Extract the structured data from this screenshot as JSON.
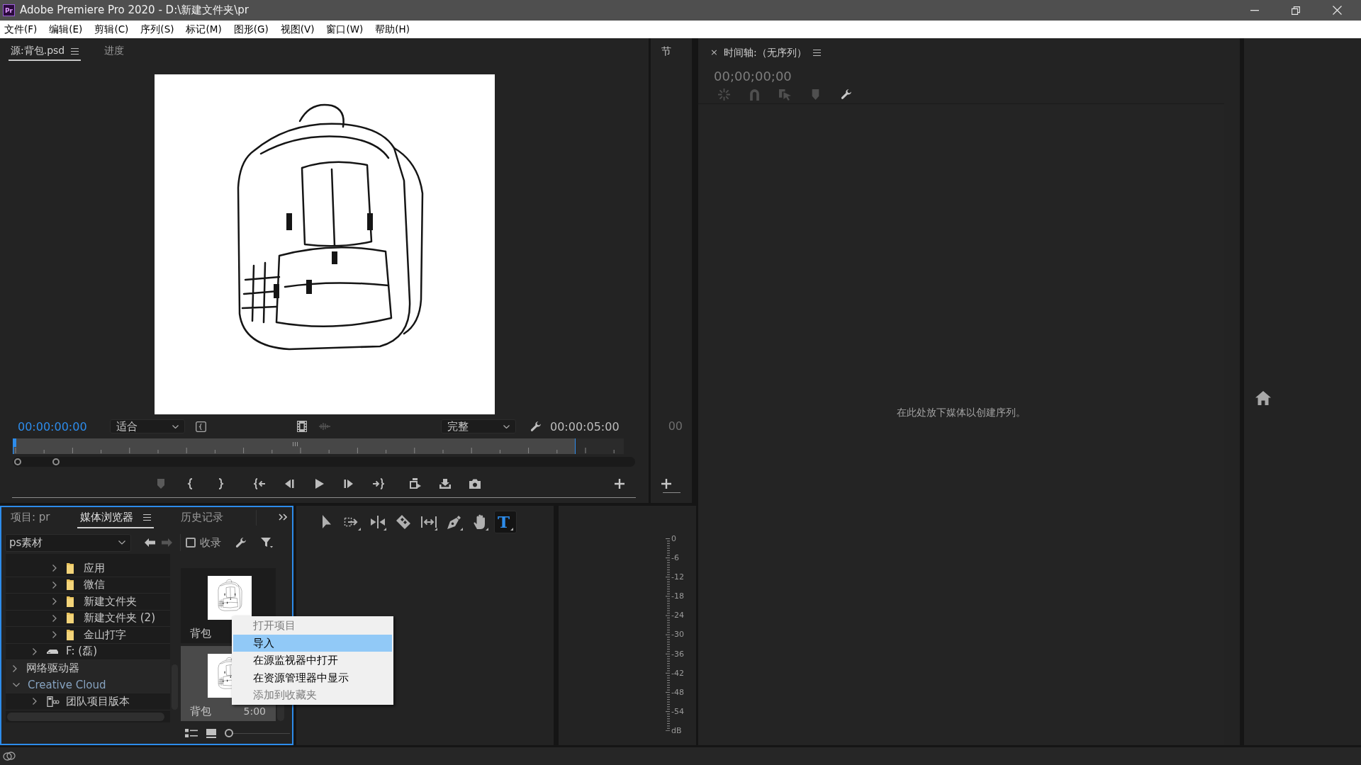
{
  "window": {
    "logo_text": "Pr",
    "title": "Adobe Premiere Pro 2020 - D:\\新建文件夹\\pr"
  },
  "menu_bar": [
    "文件(F)",
    "编辑(E)",
    "剪辑(C)",
    "序列(S)",
    "标记(M)",
    "图形(G)",
    "视图(V)",
    "窗口(W)",
    "帮助(H)"
  ],
  "source_monitor": {
    "tabs": [
      {
        "label": "源:背包.psd",
        "selected": true
      },
      {
        "label": "进度",
        "selected": false
      }
    ],
    "timecode": "00:00:00:00",
    "zoom_setting": "适合",
    "view_buttons": [
      {
        "kind": "video",
        "disabled": false
      },
      {
        "kind": "audio",
        "disabled": true
      }
    ],
    "resolution": "完整",
    "duration": "00:00:05:00",
    "transport": [
      {
        "kind": "marker",
        "disabled": true
      },
      {
        "kind": "mark_in",
        "disabled": false
      },
      {
        "kind": "mark_out",
        "disabled": false
      },
      {
        "kind": "go_to_in",
        "disabled": false
      },
      {
        "kind": "step_back",
        "disabled": false
      },
      {
        "kind": "play",
        "disabled": false
      },
      {
        "kind": "step_forward",
        "disabled": false
      },
      {
        "kind": "go_to_out",
        "disabled": false
      },
      {
        "kind": "insert",
        "disabled": false
      },
      {
        "kind": "overwrite",
        "disabled": false
      },
      {
        "kind": "export_frame",
        "disabled": false
      }
    ]
  },
  "section_panel": {
    "title": "节",
    "timecode": "00"
  },
  "timeline": {
    "close_glyph": "×",
    "title": "时间轴:（无序列）",
    "timecode": "00;00;00;00",
    "toolbar": [
      {
        "kind": "nest",
        "disabled": true
      },
      {
        "kind": "snap",
        "disabled": true
      },
      {
        "kind": "linked",
        "disabled": true
      },
      {
        "kind": "marker",
        "disabled": true
      },
      {
        "kind": "settings",
        "disabled": false
      }
    ],
    "empty_message": "在此处放下媒体以创建序列。"
  },
  "project_panel": {
    "tabs": [
      {
        "label": "项目: pr",
        "selected": false
      },
      {
        "label": "媒体浏览器",
        "selected": true
      },
      {
        "label": "历史记录",
        "selected": false
      }
    ],
    "location": "ps素材",
    "nav_buttons": [
      {
        "kind": "back",
        "disabled": false
      },
      {
        "kind": "forward",
        "disabled": true
      }
    ],
    "ingest": {
      "label": "收录",
      "checked": false
    },
    "tree": [
      {
        "children": [
          {
            "children": [
              {
                "label": "应用",
                "kind": "folder",
                "expanded": false
              },
              {
                "label": "微信",
                "kind": "folder",
                "expanded": false
              },
              {
                "label": "新建文件夹",
                "kind": "folder",
                "expanded": false
              },
              {
                "label": "新建文件夹 (2)",
                "kind": "folder",
                "expanded": false
              },
              {
                "label": "金山打字",
                "kind": "folder",
                "expanded": false
              }
            ]
          },
          {
            "label": "F: (磊)",
            "kind": "drive",
            "expanded": false
          }
        ]
      },
      {
        "label": "网络驱动器",
        "kind": "location",
        "expanded": false
      },
      {
        "label": "Creative Cloud",
        "kind": "cloud",
        "expanded": true,
        "children": [
          {
            "label": "团队项目版本",
            "kind": "team",
            "expanded": false
          }
        ]
      }
    ],
    "clips": [
      {
        "name": "背包",
        "selected": false
      },
      {
        "name": "背包",
        "duration": "5:00",
        "selected": true
      }
    ],
    "thumbnail_zoom": {
      "level": 0
    }
  },
  "context_menu": {
    "items": [
      {
        "label": "打开项目",
        "disabled": true,
        "selected": false
      },
      {
        "label": "导入",
        "disabled": false,
        "selected": true
      },
      {
        "label": "在源监视器中打开",
        "disabled": false,
        "selected": false
      },
      {
        "label": "在资源管理器中显示",
        "disabled": false,
        "selected": false
      },
      {
        "label": "添加到收藏夹",
        "disabled": true,
        "selected": false
      }
    ]
  },
  "tools": [
    {
      "kind": "selection",
      "selected": false
    },
    {
      "kind": "track_select",
      "selected": false
    },
    {
      "kind": "ripple",
      "selected": false
    },
    {
      "kind": "razor",
      "selected": false
    },
    {
      "kind": "slip",
      "selected": false
    },
    {
      "kind": "pen",
      "selected": false
    },
    {
      "kind": "hand",
      "selected": false
    },
    {
      "kind": "type",
      "glyph": "T",
      "selected": true
    }
  ],
  "audio_meter": {
    "scale": [
      "0",
      "-6",
      "-12",
      "-18",
      "-24",
      "-30",
      "-36",
      "-42",
      "-48",
      "-54",
      "dB"
    ]
  }
}
